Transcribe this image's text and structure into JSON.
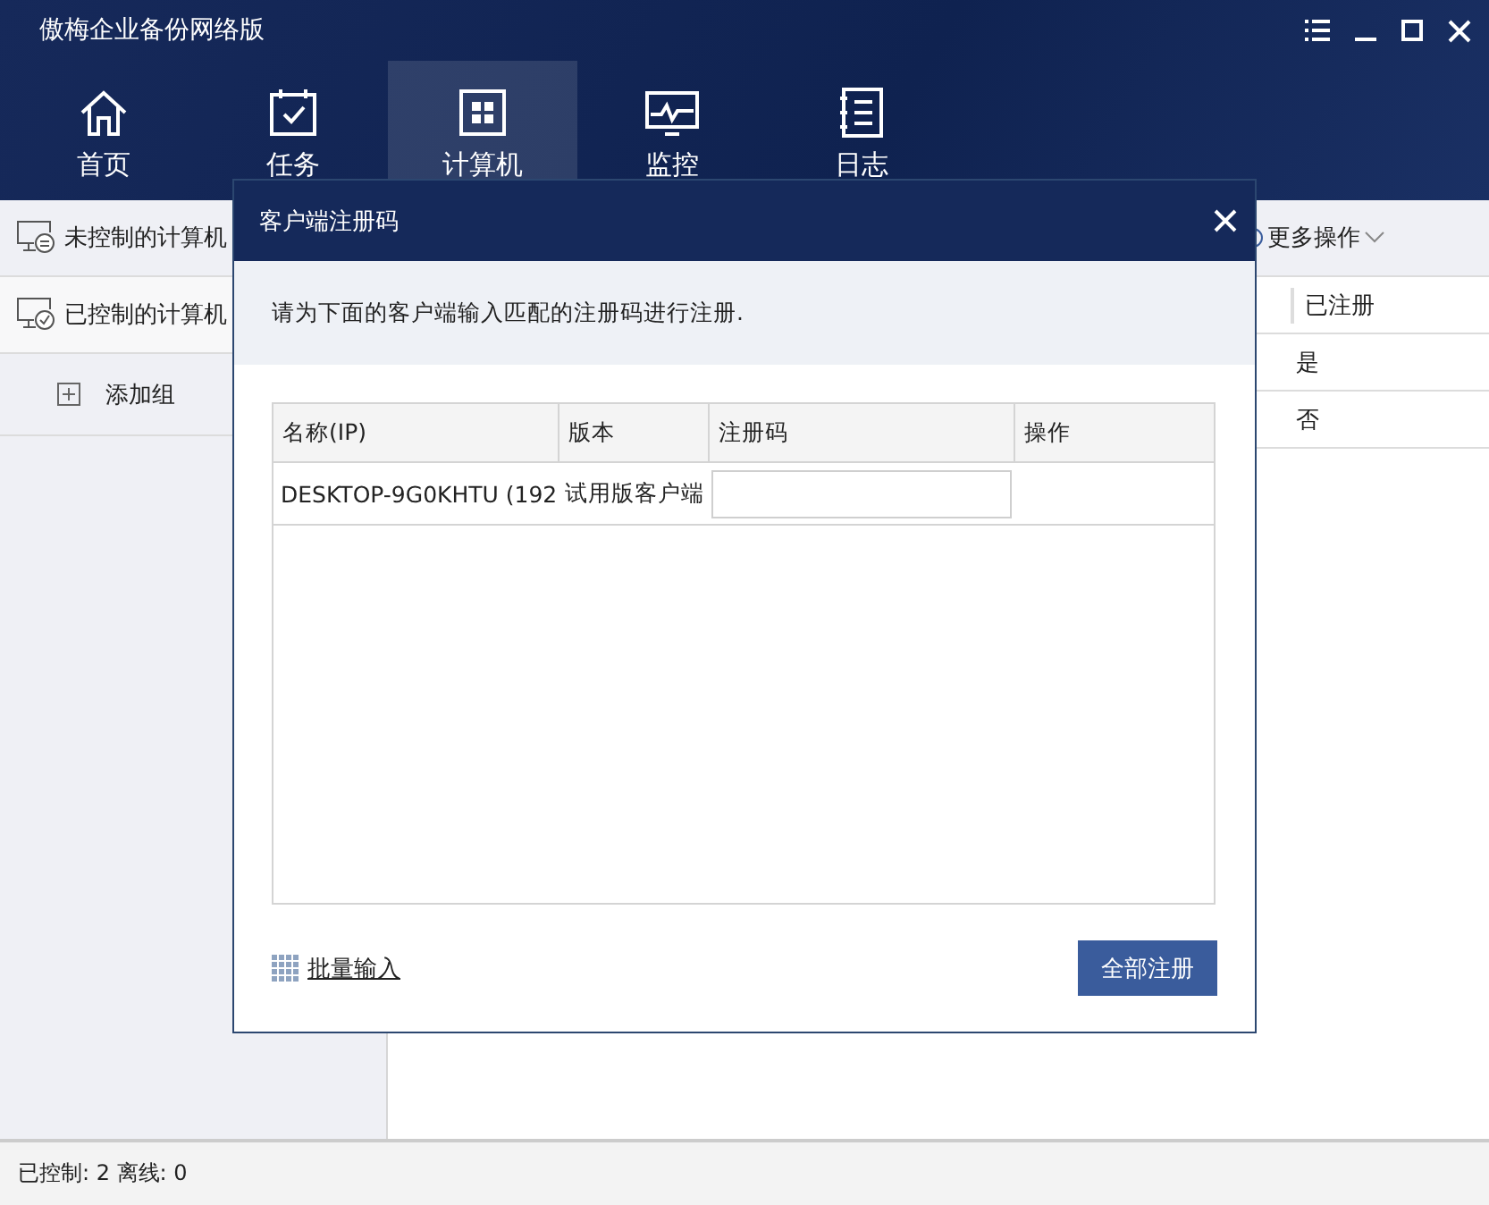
{
  "window": {
    "title": "傲梅企业备份网络版"
  },
  "nav_tabs": [
    {
      "label": "首页",
      "selected": false
    },
    {
      "label": "任务",
      "selected": false
    },
    {
      "label": "计算机",
      "selected": true
    },
    {
      "label": "监控",
      "selected": false
    },
    {
      "label": "日志",
      "selected": false
    }
  ],
  "sidebar": {
    "items": [
      {
        "label": "未控制的计算机"
      },
      {
        "label": "已控制的计算机"
      }
    ],
    "add_group": "添加组"
  },
  "toolbar": {
    "more_actions": "更多操作"
  },
  "table": {
    "columns": [
      "已注册"
    ],
    "rows": [
      [
        "是"
      ],
      [
        "否"
      ]
    ]
  },
  "dialog": {
    "title": "客户端注册码",
    "intro": "请为下面的客户端输入匹配的注册码进行注册.",
    "columns": [
      "名称(IP)",
      "版本",
      "注册码",
      "操作"
    ],
    "rows": [
      {
        "name": "DESKTOP-9G0KHTU (192",
        "version": "试用版客户端",
        "code": ""
      }
    ],
    "batch_link": "批量输入",
    "register_all": "全部注册"
  },
  "status_bar": "已控制: 2 离线: 0"
}
